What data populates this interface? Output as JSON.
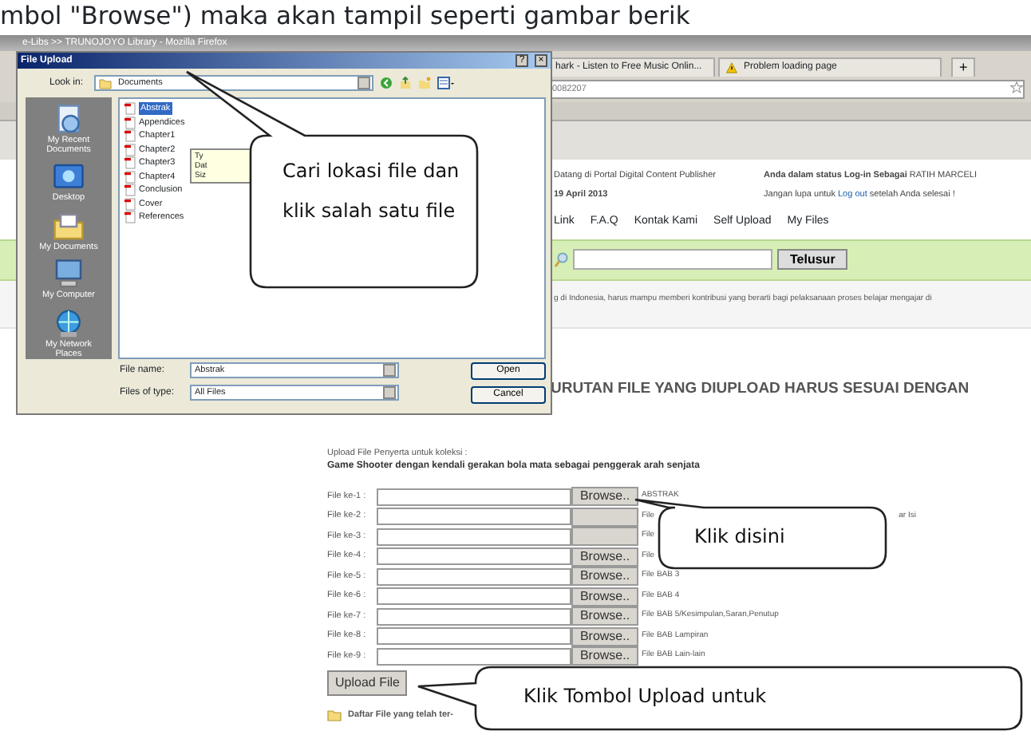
{
  "document_text": "mbol \"Browse\") maka akan tampil seperti gambar berik",
  "browser": {
    "title": "e-Libs >> TRUNOJOYO Library - Mozilla Firefox",
    "tabs": [
      {
        "label": "hark - Listen to Free Music Onlin...",
        "selected": false,
        "kind": "normal"
      },
      {
        "label": "Problem loading page",
        "selected": false,
        "kind": "warning"
      }
    ],
    "new_tab": "+",
    "url": "0082207"
  },
  "page": {
    "welcome": "Datang di Portal Digital Content Publisher",
    "date": "19 April 2013",
    "login_status": "**Anda dalam status Log-in Sebagai** RATIH MARCELI",
    "reminder_before": "Jangan lupa untuk",
    "logout_link": "Log out",
    "reminder_after": "setelah Anda selesai !",
    "nav": [
      "Link",
      "F.A.Q",
      "Kontak Kami",
      "Self Upload",
      "My Files"
    ],
    "search_button": "Telusur",
    "intro": "g di Indonesia, harus mampu memberi kontribusi yang berarti bagi pelaksanaan proses belajar mengajar di",
    "heading": "URUTAN FILE YANG DIUPLOAD HARUS SESUAI DENGAN"
  },
  "form": {
    "caption": "Upload File Penyerta untuk koleksi :",
    "title": "Game Shooter dengan kendali gerakan bola mata sebagai penggerak arah senjata",
    "rows": [
      {
        "label": "File ke-1 :",
        "browse": "Browse..",
        "description": "ABSTRAK"
      },
      {
        "label": "File ke-2 :",
        "description": "File",
        "description_end": "ar Isi"
      },
      {
        "label": "File ke-3 :",
        "description": "File"
      },
      {
        "label": "File ke-4 :",
        "browse": "Browse..",
        "description": "File"
      },
      {
        "label": "File ke-5 :",
        "browse": "Browse..",
        "description": "File BAB 3"
      },
      {
        "label": "File ke-6 :",
        "browse": "Browse..",
        "description": "File BAB 4"
      },
      {
        "label": "File ke-7 :",
        "browse": "Browse..",
        "description": "File BAB 5/Kesimpulan,Saran,Penutup"
      },
      {
        "label": "File ke-8 :",
        "browse": "Browse..",
        "description": "File BAB Lampiran"
      },
      {
        "label": "File ke-9 :",
        "browse": "Browse..",
        "description": "File BAB Lain-lain"
      }
    ],
    "upload_button": "Upload File",
    "uploaded_list_link": "Daftar File yang telah ter-"
  },
  "dialog": {
    "title": "File Upload",
    "help": "?",
    "close": "×",
    "look_in_label": "Look in:",
    "look_in_value": "Documents",
    "places": [
      {
        "label": "My Recent Documents",
        "kind": "recent"
      },
      {
        "label": "Desktop",
        "kind": "desktop"
      },
      {
        "label": "My Documents",
        "kind": "documents"
      },
      {
        "label": "My Computer",
        "kind": "computer"
      },
      {
        "label": "My Network Places",
        "kind": "network"
      }
    ],
    "files": [
      {
        "name": "Abstrak",
        "selected": true
      },
      {
        "name": "Appendices",
        "selected": false
      },
      {
        "name": "Chapter1",
        "selected": false
      },
      {
        "name": "Chapter2",
        "selected": false
      },
      {
        "name": "Chapter3",
        "selected": false
      },
      {
        "name": "Chapter4",
        "selected": false
      },
      {
        "name": "Conclusion",
        "selected": false
      },
      {
        "name": "Cover",
        "selected": false
      },
      {
        "name": "References",
        "selected": false
      }
    ],
    "tooltip": [
      "Ty",
      "Dat",
      "Siz"
    ],
    "file_name_label": "File name:",
    "file_name_value": "Abstrak",
    "file_type_label": "Files of type:",
    "file_type_value": "All Files",
    "buttons": [
      "Open",
      "Cancel"
    ]
  },
  "callouts": [
    {
      "text": "Cari lokasi file dan klik salah satu file"
    },
    {
      "text": "Klik disini"
    },
    {
      "text": "Klik Tombol Upload untuk"
    }
  ]
}
